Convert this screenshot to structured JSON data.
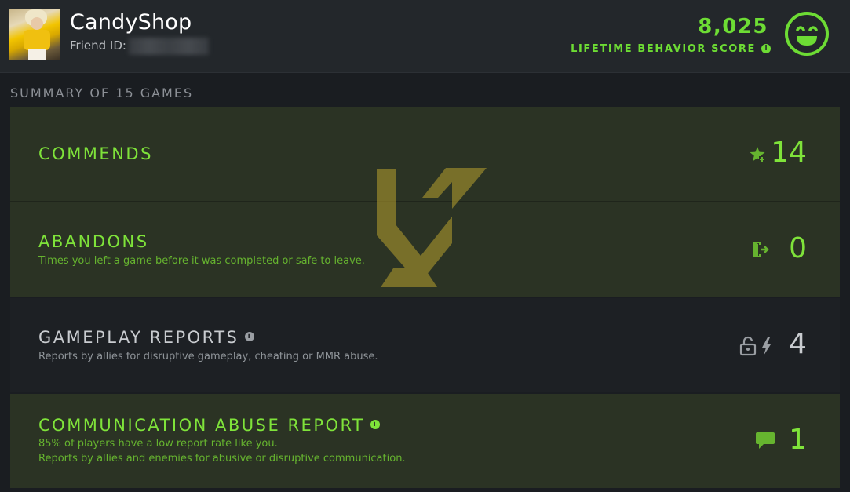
{
  "profile": {
    "username": "CandyShop",
    "friend_id_label": "Friend ID:"
  },
  "behavior": {
    "score": "8,025",
    "label": "LIFETIME BEHAVIOR SCORE",
    "info_glyph": "i"
  },
  "summary": {
    "title": "SUMMARY OF 15 GAMES"
  },
  "rows": [
    {
      "title": "COMMENDS",
      "description": "",
      "value": "14",
      "icon": "star-icon"
    },
    {
      "title": "ABANDONS",
      "description": "Times you left a game before it was completed or safe to leave.",
      "value": "0",
      "icon": "exit-door-icon"
    },
    {
      "title": "GAMEPLAY REPORTS",
      "description": "Reports by allies for disruptive gameplay, cheating or MMR abuse.",
      "value": "4",
      "icon": "lock-lightning-icon"
    },
    {
      "title": "COMMUNICATION ABUSE REPORT",
      "description_line1": "85% of players have a low report rate like you.",
      "description_line2": "Reports by allies and enemies for abusive or disruptive communication.",
      "value": "1",
      "icon": "chat-bubble-icon"
    }
  ],
  "colors": {
    "accent_green": "#7fe33a",
    "background": "#1a1d21",
    "header": "#23272b",
    "highlight_row": "#2b3324"
  }
}
